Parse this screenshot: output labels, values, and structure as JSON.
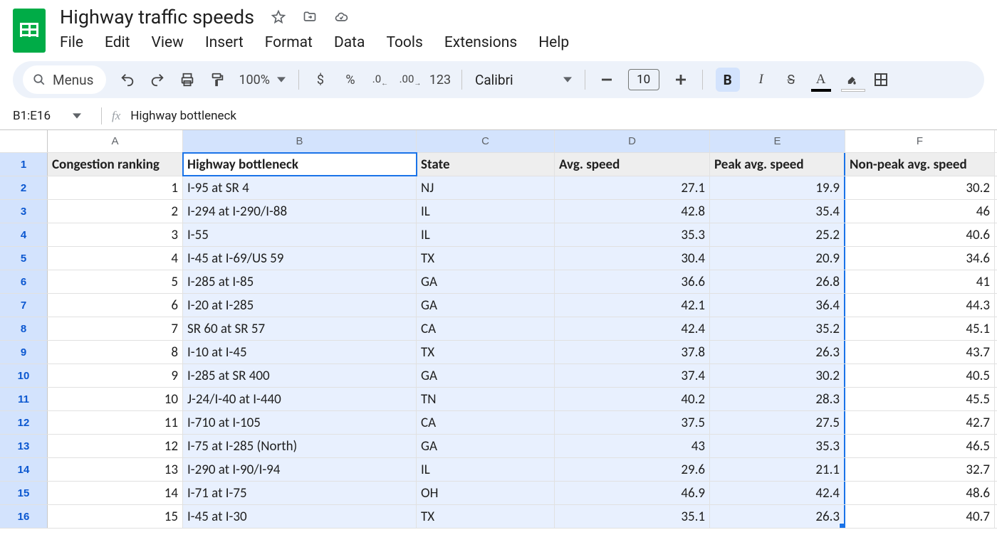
{
  "doc": {
    "title": "Highway traffic speeds"
  },
  "menu": {
    "items": [
      "File",
      "Edit",
      "View",
      "Insert",
      "Format",
      "Data",
      "Tools",
      "Extensions",
      "Help"
    ]
  },
  "toolbar": {
    "menus_label": "Menus",
    "zoom": "100%",
    "number_fmt": "123",
    "font_name": "Calibri",
    "font_size": "10",
    "dollar": "$",
    "percent": "%"
  },
  "namebox": {
    "range": "B1:E16",
    "formula": "Highway bottleneck"
  },
  "columns": [
    "A",
    "B",
    "C",
    "D",
    "E",
    "F"
  ],
  "headers": {
    "A": "Congestion ranking",
    "B": "Highway bottleneck",
    "C": "State",
    "D": "Avg. speed",
    "E": "Peak avg. speed",
    "F": "Non-peak avg. speed"
  },
  "rows": [
    {
      "rank": "1",
      "bottleneck": "I-95 at SR 4",
      "state": "NJ",
      "avg": "27.1",
      "peak": "19.9",
      "nonpeak": "30.2"
    },
    {
      "rank": "2",
      "bottleneck": "I-294 at I-290/I-88",
      "state": "IL",
      "avg": "42.8",
      "peak": "35.4",
      "nonpeak": "46"
    },
    {
      "rank": "3",
      "bottleneck": "I-55",
      "state": "IL",
      "avg": "35.3",
      "peak": "25.2",
      "nonpeak": "40.6"
    },
    {
      "rank": "4",
      "bottleneck": "I-45 at I-69/US 59",
      "state": "TX",
      "avg": "30.4",
      "peak": "20.9",
      "nonpeak": "34.6"
    },
    {
      "rank": "5",
      "bottleneck": "I-285 at I-85",
      "state": "GA",
      "avg": "36.6",
      "peak": "26.8",
      "nonpeak": "41"
    },
    {
      "rank": "6",
      "bottleneck": "I-20 at I-285",
      "state": "GA",
      "avg": "42.1",
      "peak": "36.4",
      "nonpeak": "44.3"
    },
    {
      "rank": "7",
      "bottleneck": "SR 60 at SR 57",
      "state": "CA",
      "avg": "42.4",
      "peak": "35.2",
      "nonpeak": "45.1"
    },
    {
      "rank": "8",
      "bottleneck": "I-10 at I-45",
      "state": "TX",
      "avg": "37.8",
      "peak": "26.3",
      "nonpeak": "43.7"
    },
    {
      "rank": "9",
      "bottleneck": "I-285 at SR 400",
      "state": "GA",
      "avg": "37.4",
      "peak": "30.2",
      "nonpeak": "40.5"
    },
    {
      "rank": "10",
      "bottleneck": "J-24/I-40 at I-440",
      "state": "TN",
      "avg": "40.2",
      "peak": "28.3",
      "nonpeak": "45.5"
    },
    {
      "rank": "11",
      "bottleneck": "I-710 at I-105",
      "state": "CA",
      "avg": "37.5",
      "peak": "27.5",
      "nonpeak": "42.7"
    },
    {
      "rank": "12",
      "bottleneck": "I-75 at I-285 (North)",
      "state": "GA",
      "avg": "43",
      "peak": "35.3",
      "nonpeak": "46.5"
    },
    {
      "rank": "13",
      "bottleneck": "I-290 at I-90/I-94",
      "state": "IL",
      "avg": "29.6",
      "peak": "21.1",
      "nonpeak": "32.7"
    },
    {
      "rank": "14",
      "bottleneck": "I-71 at I-75",
      "state": "OH",
      "avg": "46.9",
      "peak": "42.4",
      "nonpeak": "48.6"
    },
    {
      "rank": "15",
      "bottleneck": "I-45 at I-30",
      "state": "TX",
      "avg": "35.1",
      "peak": "26.3",
      "nonpeak": "40.7"
    }
  ]
}
